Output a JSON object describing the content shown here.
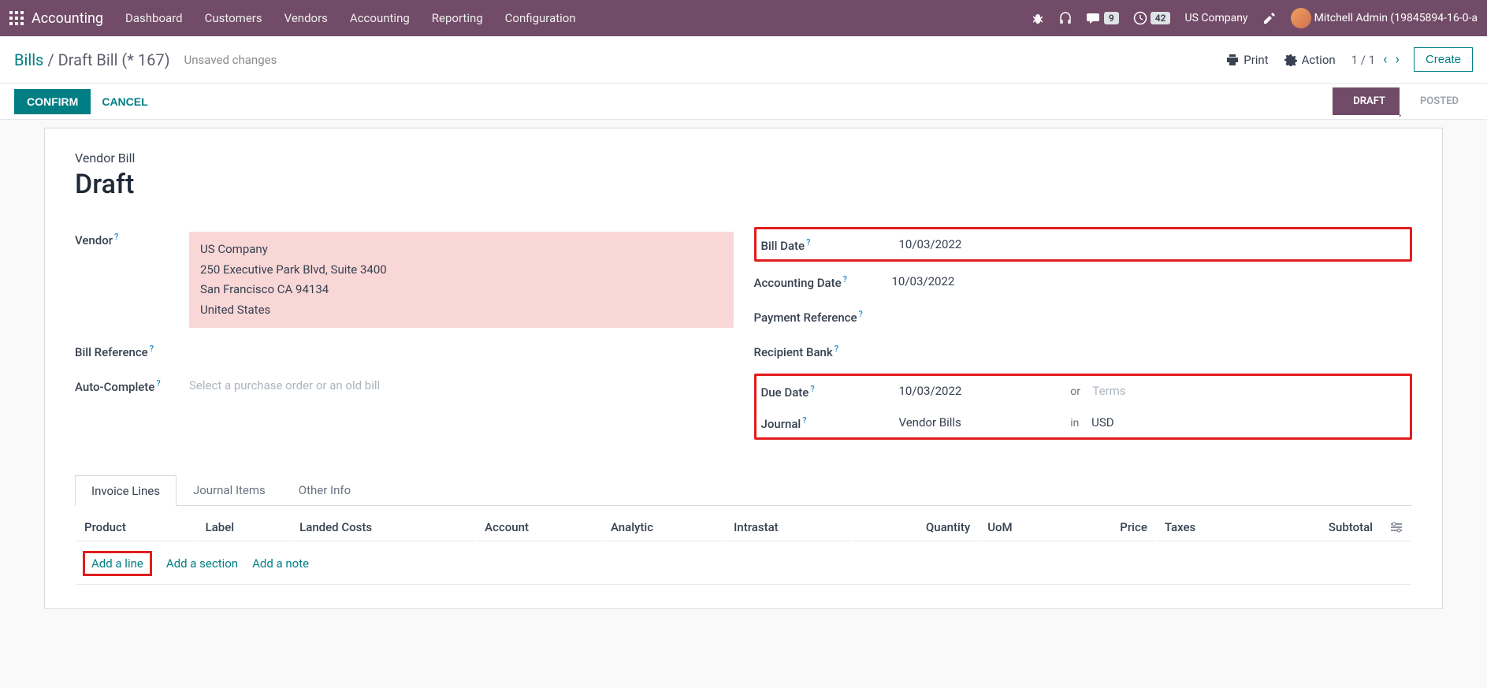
{
  "nav": {
    "app": "Accounting",
    "menu": [
      "Dashboard",
      "Customers",
      "Vendors",
      "Accounting",
      "Reporting",
      "Configuration"
    ],
    "messages_count": "9",
    "activities_count": "42",
    "company": "US Company",
    "user": "Mitchell Admin (19845894-16-0-a"
  },
  "breadcrumb": {
    "parent": "Bills",
    "sep": " / ",
    "current": "Draft Bill (* 167)",
    "unsaved": "Unsaved changes"
  },
  "controls": {
    "print": "Print",
    "action": "Action",
    "pager": "1 / 1",
    "create": "Create"
  },
  "statusbar": {
    "confirm": "CONFIRM",
    "cancel": "CANCEL",
    "draft": "DRAFT",
    "posted": "POSTED"
  },
  "form": {
    "doc_type": "Vendor Bill",
    "doc_title": "Draft",
    "left": {
      "vendor_label": "Vendor",
      "vendor_name": "US Company",
      "vendor_street": "250 Executive Park Blvd, Suite 3400",
      "vendor_city": "San Francisco CA 94134",
      "vendor_country": "United States",
      "bill_ref_label": "Bill Reference",
      "autocomplete_label": "Auto-Complete",
      "autocomplete_placeholder": "Select a purchase order or an old bill"
    },
    "right": {
      "bill_date_label": "Bill Date",
      "bill_date": "10/03/2022",
      "acct_date_label": "Accounting Date",
      "acct_date": "10/03/2022",
      "pay_ref_label": "Payment Reference",
      "recipient_bank_label": "Recipient Bank",
      "due_date_label": "Due Date",
      "due_date": "10/03/2022",
      "or": "or",
      "terms_placeholder": "Terms",
      "journal_label": "Journal",
      "journal": "Vendor Bills",
      "in": "in",
      "currency": "USD"
    }
  },
  "tabs": {
    "invoice_lines": "Invoice Lines",
    "journal_items": "Journal Items",
    "other_info": "Other Info"
  },
  "table": {
    "cols": {
      "product": "Product",
      "label": "Label",
      "landed": "Landed Costs",
      "account": "Account",
      "analytic": "Analytic",
      "intrastat": "Intrastat",
      "quantity": "Quantity",
      "uom": "UoM",
      "price": "Price",
      "taxes": "Taxes",
      "subtotal": "Subtotal"
    },
    "add_line": "Add a line",
    "add_section": "Add a section",
    "add_note": "Add a note"
  }
}
